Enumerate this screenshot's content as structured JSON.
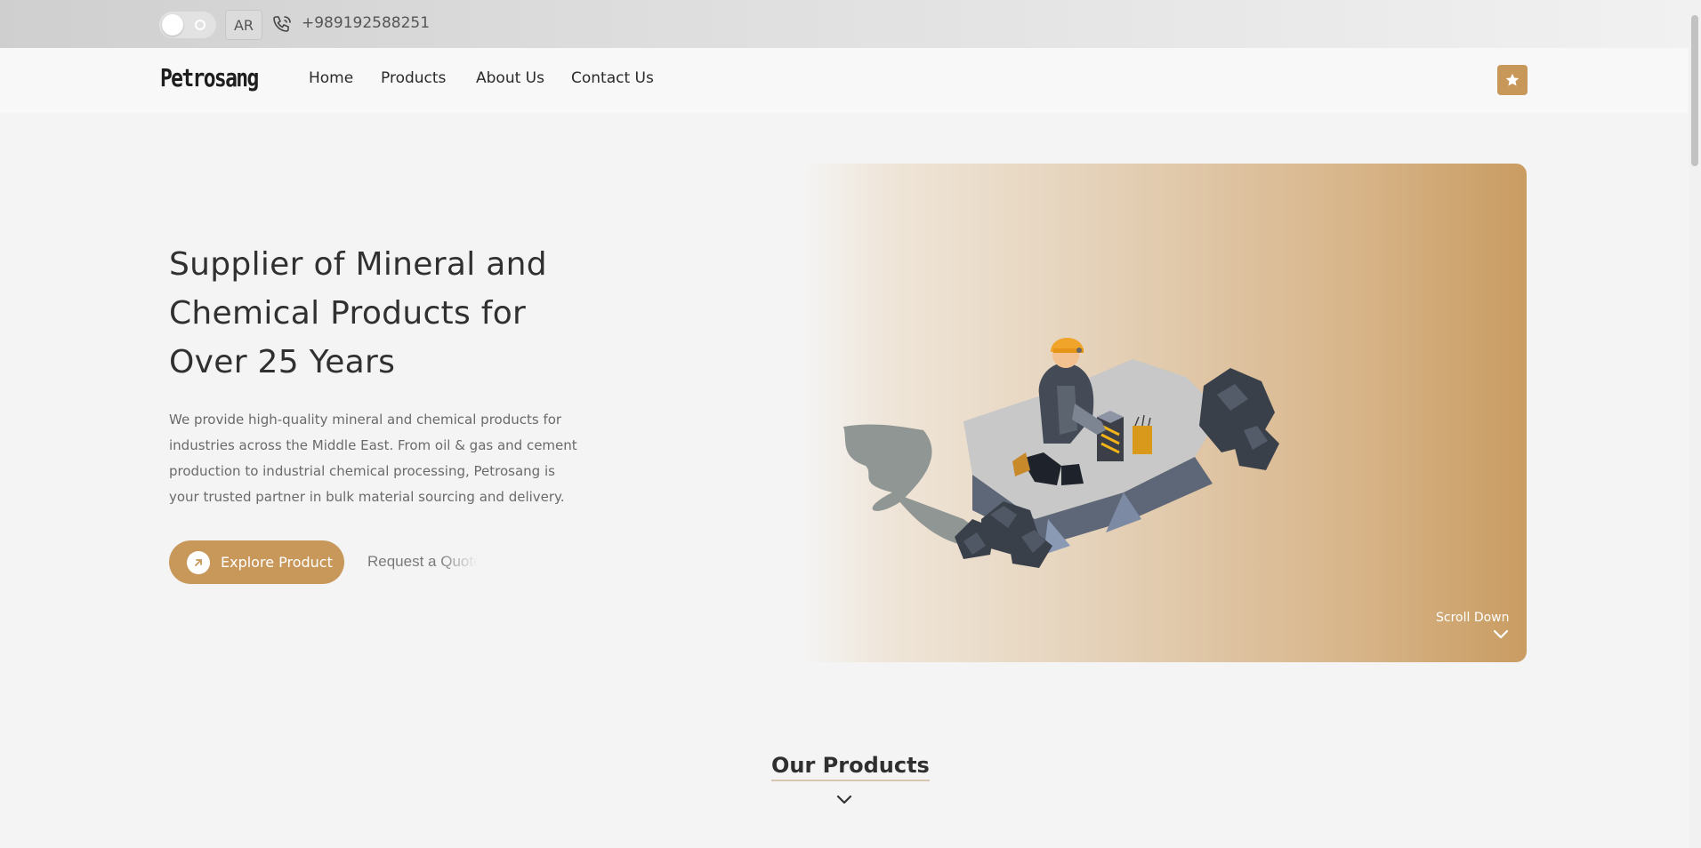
{
  "topbar": {
    "theme_toggle": "light",
    "language": "AR",
    "phone": "+989192588251"
  },
  "nav": {
    "logo": "Petrosang",
    "links": [
      "Home",
      "Products",
      "About Us",
      "Contact Us"
    ],
    "favorite_icon": "star-icon"
  },
  "hero": {
    "title_lines": [
      "Supplier of Mineral and",
      "Chemical Products for",
      "Over 25 Years"
    ],
    "description": "We provide high-quality mineral and chemical products for industries across the Middle East. From oil & gas and cement production to industrial chemical processing, Petrosang is your trusted partner in bulk material sourcing and delivery.",
    "explore_label": "Explore Product",
    "quote_label": "Request a Quote",
    "scroll_label": "Scroll Down"
  },
  "products": {
    "title": "Our Products"
  },
  "colors": {
    "accent": "#c8975a",
    "text": "#303030",
    "muted": "#6a6a6a"
  }
}
